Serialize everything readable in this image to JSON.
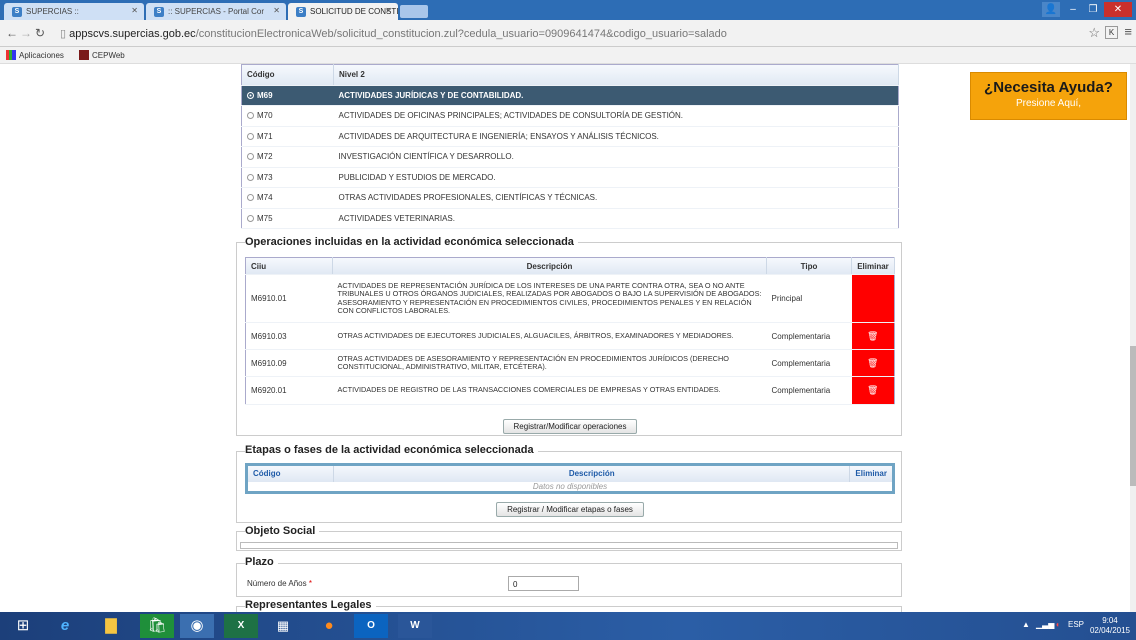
{
  "browser": {
    "tabs": [
      {
        "title": "SUPERCIAS ::",
        "active": false
      },
      {
        "title": ":: SUPERCIAS - Portal Cor",
        "active": false
      },
      {
        "title": "SOLICITUD DE CONSTITU",
        "active": true
      }
    ],
    "url_host": "appscvs.supercias.gob.ec",
    "url_path": "/constitucionElectronicaWeb/solicitud_constitucion.zul?cedula_usuario=0909641474&codigo_usuario=salado",
    "bookmarks": [
      "Aplicaciones",
      "CEPWeb"
    ]
  },
  "help": {
    "title": "¿Necesita Ayuda?",
    "subtitle": "Presione Aquí,"
  },
  "nivel2": {
    "headers": [
      "Código",
      "Nivel 2"
    ],
    "rows": [
      {
        "code": "M69",
        "name": "ACTIVIDADES JURÍDICAS Y DE CONTABILIDAD.",
        "selected": true
      },
      {
        "code": "M70",
        "name": "ACTIVIDADES DE OFICINAS PRINCIPALES; ACTIVIDADES DE CONSULTORÍA DE GESTIÓN.",
        "selected": false
      },
      {
        "code": "M71",
        "name": "ACTIVIDADES DE ARQUITECTURA E INGENIERÍA; ENSAYOS Y ANÁLISIS TÉCNICOS.",
        "selected": false
      },
      {
        "code": "M72",
        "name": "INVESTIGACIÓN CIENTÍFICA Y DESARROLLO.",
        "selected": false
      },
      {
        "code": "M73",
        "name": "PUBLICIDAD Y ESTUDIOS DE MERCADO.",
        "selected": false
      },
      {
        "code": "M74",
        "name": "OTRAS ACTIVIDADES PROFESIONALES, CIENTÍFICAS Y TÉCNICAS.",
        "selected": false
      },
      {
        "code": "M75",
        "name": "ACTIVIDADES VETERINARIAS.",
        "selected": false
      }
    ]
  },
  "operaciones": {
    "legend": "Operaciones incluidas en la actividad económica seleccionada",
    "headers": [
      "Ciiu",
      "Descripción",
      "Tipo",
      "Eliminar"
    ],
    "rows": [
      {
        "ciiu": "M6910.01",
        "desc": "ACTIVIDADES DE REPRESENTACIÓN JURÍDICA DE LOS INTERESES DE UNA PARTE CONTRA OTRA, SEA O NO ANTE TRIBUNALES U OTROS ÓRGANOS JUDICIALES, REALIZADAS POR ABOGADOS O BAJO LA SUPERVISIÓN DE ABOGADOS: ASESORAMIENTO Y REPRESENTACIÓN EN PROCEDIMIENTOS CIVILES, PROCEDIMIENTOS PENALES Y EN RELACIÓN CON CONFLICTOS LABORALES.",
        "tipo": "Principal",
        "deletable": false
      },
      {
        "ciiu": "M6910.03",
        "desc": "OTRAS ACTIVIDADES DE EJECUTORES JUDICIALES, ALGUACILES, ÁRBITROS, EXAMINADORES Y MEDIADORES.",
        "tipo": "Complementaria",
        "deletable": true
      },
      {
        "ciiu": "M6910.09",
        "desc": "OTRAS ACTIVIDADES DE ASESORAMIENTO Y REPRESENTACIÓN EN PROCEDIMIENTOS JURÍDICOS (DERECHO CONSTITUCIONAL, ADMINISTRATIVO, MILITAR, ETCÉTERA).",
        "tipo": "Complementaria",
        "deletable": true
      },
      {
        "ciiu": "M6920.01",
        "desc": "ACTIVIDADES DE REGISTRO DE LAS TRANSACCIONES COMERCIALES DE EMPRESAS Y OTRAS ENTIDADES.",
        "tipo": "Complementaria",
        "deletable": true
      }
    ],
    "button": "Registrar/Modificar operaciones"
  },
  "etapas": {
    "legend": "Etapas o fases de la actividad económica seleccionada",
    "headers": [
      "Código",
      "Descripción",
      "Eliminar"
    ],
    "empty": "Datos no disponibles",
    "button": "Registrar / Modificar etapas o fases"
  },
  "objeto_social": {
    "legend": "Objeto Social"
  },
  "plazo": {
    "legend": "Plazo",
    "label": "Número de Años",
    "required": "*",
    "value": "0"
  },
  "representantes": {
    "legend": "Representantes Legales"
  },
  "taskbar": {
    "lang": "ESP",
    "time": "9:04",
    "date": "02/04/2015"
  },
  "colors": {
    "selected_row": "#3c5a72",
    "delete_cell": "#ff0000",
    "help_bg": "#f5a30b",
    "header_text": "#1f5ba8"
  }
}
